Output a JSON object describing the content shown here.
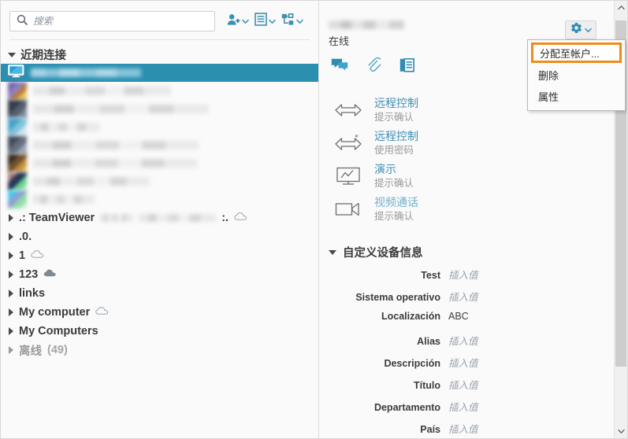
{
  "search": {
    "placeholder": "搜索",
    "value": "",
    "icon": "search-icon"
  },
  "toolbar": {
    "icons": [
      {
        "name": "add-contact-icon",
        "label": "添加联系人"
      },
      {
        "name": "list-icon",
        "label": "列表"
      },
      {
        "name": "group-icon",
        "label": "分组"
      }
    ]
  },
  "sidebar": {
    "recent_group": {
      "label": "近期连接",
      "expanded": true
    },
    "recent_items": [
      {
        "name": "redacted-device-1",
        "selected": true,
        "icon": "monitor-icon"
      },
      {
        "name": "redacted-device-2",
        "selected": false,
        "icon": "avatar"
      },
      {
        "name": "redacted-device-3",
        "selected": false,
        "icon": "avatar"
      },
      {
        "name": "redacted-device-4",
        "selected": false,
        "icon": "avatar"
      },
      {
        "name": "redacted-device-5",
        "selected": false,
        "icon": "avatar"
      },
      {
        "name": "redacted-device-6",
        "selected": false,
        "icon": "avatar"
      },
      {
        "name": "redacted-device-7",
        "selected": false,
        "icon": "avatar"
      },
      {
        "name": "redacted-device-8",
        "selected": false,
        "icon": "avatar"
      }
    ],
    "groups": [
      {
        "label": ".: TeamViewer",
        "suffix": ":.",
        "redacted": true,
        "cloud": "outline",
        "muted": false
      },
      {
        "label": ".0.",
        "suffix": "",
        "redacted": false,
        "cloud": "none",
        "muted": false
      },
      {
        "label": "1",
        "suffix": "",
        "redacted": false,
        "cloud": "outline",
        "muted": false
      },
      {
        "label": "123",
        "suffix": "",
        "redacted": false,
        "cloud": "filled",
        "muted": false
      },
      {
        "label": "links",
        "suffix": "",
        "redacted": false,
        "cloud": "none",
        "muted": false
      },
      {
        "label": "My computer",
        "suffix": "",
        "redacted": false,
        "cloud": "outline",
        "muted": false
      },
      {
        "label": "My Computers",
        "suffix": "",
        "redacted": false,
        "cloud": "none",
        "muted": false
      },
      {
        "label": "离线",
        "suffix": "",
        "count": "(49)",
        "redacted": false,
        "cloud": "none",
        "muted": true
      }
    ]
  },
  "device": {
    "name_redacted": true,
    "status": "在线",
    "quick_icons": [
      {
        "name": "chat-icon"
      },
      {
        "name": "paperclip-icon"
      },
      {
        "name": "documents-icon"
      }
    ],
    "gear": {
      "name": "gear-icon"
    }
  },
  "menu": {
    "items": [
      {
        "label": "分配至帐户...",
        "active": true
      },
      {
        "label": "删除",
        "active": false
      },
      {
        "label": "属性",
        "active": false
      }
    ]
  },
  "actions": [
    {
      "icon": "remote-control-icon",
      "title": "远程控制",
      "subtitle": "提示确认",
      "dim": false
    },
    {
      "icon": "remote-control-password-icon",
      "title": "远程控制",
      "subtitle": "使用密码",
      "dim": false
    },
    {
      "icon": "presentation-icon",
      "title": "演示",
      "subtitle": "提示确认",
      "dim": false
    },
    {
      "icon": "video-call-icon",
      "title": "视频通话",
      "subtitle": "提示确认",
      "dim": true
    }
  ],
  "custom_info": {
    "header": "自定义设备信息",
    "expanded": true,
    "placeholder": "插入值",
    "fields": [
      {
        "key": "Test",
        "value": "插入值",
        "is_placeholder": true
      },
      {
        "key": "Sistema operativo",
        "value": "插入值",
        "is_placeholder": true
      },
      {
        "key": "Localización",
        "value": "ABC",
        "is_placeholder": false
      },
      {
        "key": "Alias",
        "value": "插入值",
        "is_placeholder": true
      },
      {
        "key": "Descripción",
        "value": "插入值",
        "is_placeholder": true
      },
      {
        "key": "Título",
        "value": "插入值",
        "is_placeholder": true
      },
      {
        "key": "Departamento",
        "value": "插入值",
        "is_placeholder": true
      },
      {
        "key": "País",
        "value": "插入值",
        "is_placeholder": true
      }
    ]
  },
  "colors": {
    "accent": "#2b8fb0",
    "link": "#3d8fb5",
    "highlight_border": "#f08a1c",
    "icon_blue": "#3d8fb5"
  }
}
